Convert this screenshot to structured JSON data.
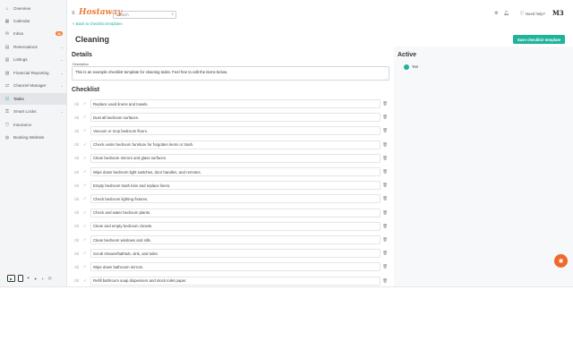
{
  "sidebar": {
    "items": [
      {
        "label": "Overview",
        "icon": "home-icon"
      },
      {
        "label": "Calendar",
        "icon": "calendar-icon"
      },
      {
        "label": "Inbox",
        "icon": "inbox-icon",
        "badge": "28"
      },
      {
        "label": "Reservations",
        "icon": "reservations-icon"
      },
      {
        "label": "Listings",
        "icon": "listings-icon"
      },
      {
        "label": "Financial Reporting",
        "icon": "chart-icon"
      },
      {
        "label": "Channel Manager",
        "icon": "channel-icon"
      },
      {
        "label": "Tasks",
        "icon": "tasks-icon"
      },
      {
        "label": "Smart Locks",
        "icon": "lock-icon"
      },
      {
        "label": "Insurance",
        "icon": "shield-icon"
      },
      {
        "label": "Booking Website",
        "icon": "globe-icon"
      }
    ]
  },
  "topbar": {
    "logo": "Hostaway",
    "search_placeholder": "Search",
    "need_help": "Need help?",
    "avatar": "M3"
  },
  "page": {
    "back_link": "< Back to checklist templates",
    "title": "Cleaning",
    "save_button": "Save checklist template"
  },
  "details": {
    "heading": "Details",
    "description_label": "Description",
    "description_value": "This is an example checklist template for cleaning tasks. Feel free to edit the items below."
  },
  "checklist": {
    "heading": "Checklist",
    "items": [
      "Replace used linens and towels.",
      "Dust all bedroom surfaces.",
      "Vacuum or mop bedroom floors.",
      "Check under bedroom furniture for forgotten items or trash.",
      "Clean bedroom mirrors and glass surfaces.",
      "Wipe down bedroom light switches, door handles, and remotes.",
      "Empty bedroom trash bins and replace liners.",
      "Check bedroom lighting fixtures.",
      "Check and water bedroom plants.",
      "Clean and empty bedroom closets.",
      "Clean bedroom windows and sills.",
      "Scrub shower/bathtub, sink, and toilet.",
      "Wipe down bathroom mirrors.",
      "Refill bathroom soap dispensers and stock toilet paper."
    ]
  },
  "active": {
    "heading": "Active",
    "option": "Yes",
    "selected": true
  },
  "colors": {
    "accent": "#1fb39c",
    "brand": "#ef7d3b"
  }
}
